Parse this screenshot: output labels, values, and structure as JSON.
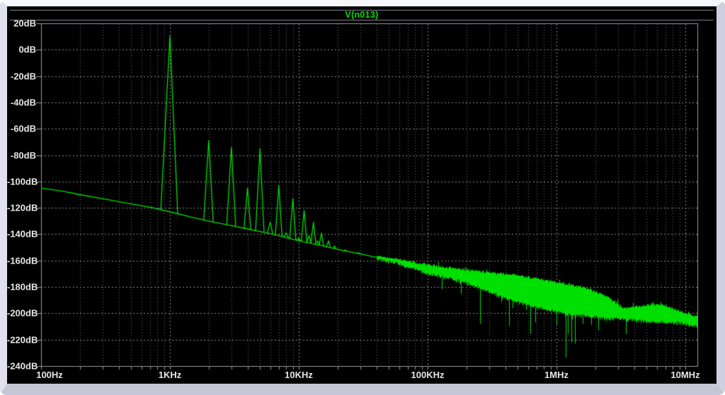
{
  "legend": {
    "trace_label": "V(n013)"
  },
  "colors": {
    "background": "#000000",
    "trace": "#00E000",
    "grid_major": "#8E8E8E",
    "grid_minor": "#6F6F6F",
    "axis_border": "#9A9A9A",
    "tick_text": "#E6E6E6",
    "legend_rule": "#8A8A9A",
    "frame_top": "#F6F6FD",
    "frame_left": "#E0E0EF",
    "frame_right": "#CFCFDF",
    "frame_bottom": "#C6C6D6"
  },
  "chart_data": {
    "type": "line",
    "title": "V(n013)",
    "legend_position": "top-center",
    "grid": true,
    "x_axis": {
      "scale": "log",
      "unit": "Hz",
      "min": 100,
      "max": 12400000,
      "tick_labels": [
        "100Hz",
        "1KHz",
        "10KHz",
        "100KHz",
        "1MHz",
        "10MHz"
      ],
      "tick_values": [
        100,
        1000,
        10000,
        100000,
        1000000,
        10000000
      ]
    },
    "y_axis": {
      "scale": "linear",
      "unit": "dB",
      "min": -240,
      "max": 20,
      "step": 20,
      "tick_labels": [
        "20dB",
        "0dB",
        "-20dB",
        "-40dB",
        "-60dB",
        "-80dB",
        "-100dB",
        "-120dB",
        "-140dB",
        "-160dB",
        "-180dB",
        "-200dB",
        "-220dB",
        "-240dB"
      ],
      "tick_values": [
        20,
        0,
        -20,
        -40,
        -60,
        -80,
        -100,
        -120,
        -140,
        -160,
        -180,
        -200,
        -220,
        -240
      ]
    },
    "series": [
      {
        "name": "V(n013)",
        "color": "#00E000",
        "noise_floor_db": [
          [
            100,
            -105
          ],
          [
            150,
            -107.5
          ],
          [
            200,
            -110
          ],
          [
            300,
            -113
          ],
          [
            500,
            -117
          ],
          [
            700,
            -119.5
          ],
          [
            1000,
            -123
          ],
          [
            1400,
            -126.5
          ],
          [
            2000,
            -130
          ],
          [
            3000,
            -133.5
          ],
          [
            4000,
            -136
          ],
          [
            5000,
            -138
          ],
          [
            7000,
            -141
          ],
          [
            10000,
            -145
          ],
          [
            14000,
            -148
          ],
          [
            20000,
            -151.5
          ],
          [
            30000,
            -155
          ],
          [
            40000,
            -157.5
          ]
        ],
        "harmonic_peaks_db": [
          [
            1000,
            10.5,
            0.15
          ],
          [
            2000,
            -69,
            0.085
          ],
          [
            3000,
            -74,
            0.08
          ],
          [
            4000,
            -105,
            0.06
          ],
          [
            5000,
            -75,
            0.075
          ],
          [
            6000,
            -131,
            0.05
          ],
          [
            7000,
            -103,
            0.06
          ],
          [
            8000,
            -139,
            0.045
          ],
          [
            9000,
            -113,
            0.055
          ],
          [
            10000,
            -143,
            0.04
          ],
          [
            11000,
            -122,
            0.05
          ],
          [
            12000,
            -141,
            0.04
          ],
          [
            13000,
            -131,
            0.045
          ],
          [
            14000,
            -145,
            0.035
          ],
          [
            15000,
            -139,
            0.04
          ],
          [
            17000,
            -145,
            0.035
          ],
          [
            19000,
            -149,
            0.03
          ],
          [
            23000,
            -152,
            0.03
          ],
          [
            29000,
            -154,
            0.025
          ]
        ],
        "noise_band_db": [
          [
            40000,
            -156.8,
            -158.3
          ],
          [
            60000,
            -159.5,
            -162
          ],
          [
            100000,
            -163.5,
            -169.5
          ],
          [
            150000,
            -166,
            -173
          ],
          [
            250000,
            -168.5,
            -180
          ],
          [
            400000,
            -170.5,
            -188
          ],
          [
            700000,
            -174,
            -195
          ],
          [
            1200000,
            -178,
            -200
          ],
          [
            1800000,
            -182,
            -202
          ],
          [
            2500000,
            -188,
            -203.5
          ],
          [
            3300000,
            -196.5,
            -203.5
          ],
          [
            4500000,
            -194.5,
            -205.5
          ],
          [
            6500000,
            -193.5,
            -206.5
          ],
          [
            9000000,
            -198.5,
            -207
          ],
          [
            11000000,
            -201.5,
            -208.5
          ],
          [
            12400000,
            -203,
            -209
          ]
        ]
      }
    ]
  }
}
